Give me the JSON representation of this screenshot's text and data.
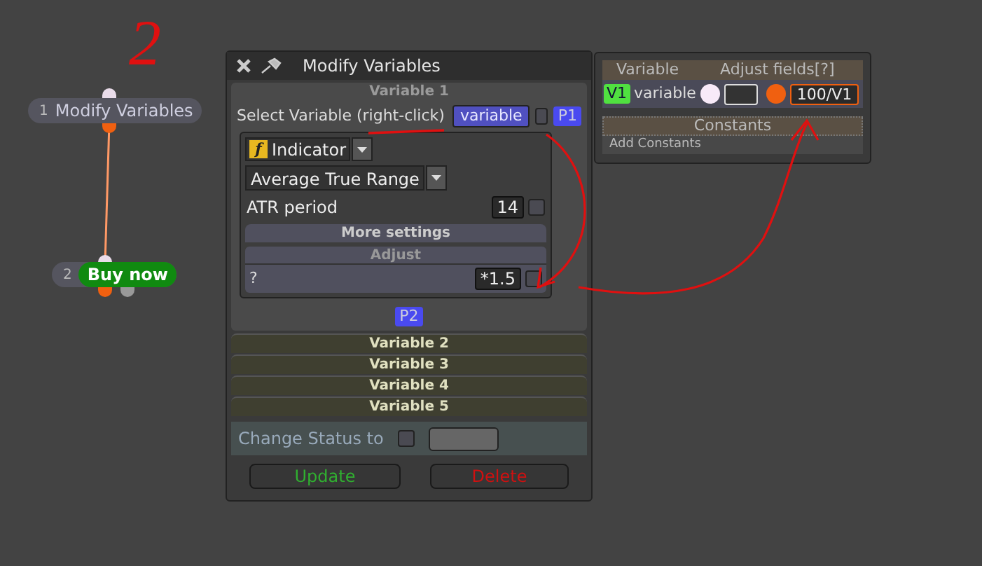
{
  "annotation": {
    "label": "2"
  },
  "nodes": [
    {
      "number": "1",
      "label": "Modify Variables",
      "kind": "plain"
    },
    {
      "number": "2",
      "label": "Buy now",
      "kind": "action"
    }
  ],
  "dialog": {
    "title": "Modify Variables",
    "variable_header": "Variable 1",
    "select_label": "Select Variable (right-click)",
    "variable_button": "variable",
    "variable_checked": false,
    "p1": "P1",
    "indicator_icon": "f",
    "indicator_type": "Indicator",
    "indicator": "Average True Range",
    "params": [
      {
        "label": "ATR period",
        "value": "14",
        "checked": false
      }
    ],
    "more_settings": "More settings",
    "adjust_header": "Adjust",
    "adjust_label": "?",
    "adjust_value": "*1.5",
    "adjust_checked": false,
    "p2": "P2",
    "collapsed": [
      "Variable 2",
      "Variable 3",
      "Variable 4",
      "Variable 5"
    ],
    "status_label": "Change Status to",
    "status_checked": false,
    "update": "Update",
    "delete": "Delete"
  },
  "variables_panel": {
    "columns": [
      "Variable",
      "Adjust fields[?]"
    ],
    "rows": [
      {
        "tag": "V1",
        "name": "variable",
        "formula": "100/V1"
      }
    ],
    "constants_header": "Constants",
    "add_constants": "Add Constants"
  }
}
